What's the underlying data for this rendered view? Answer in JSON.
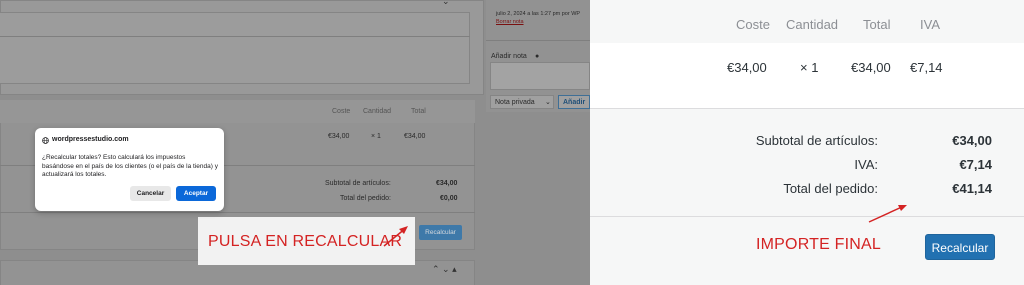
{
  "left": {
    "note_meta": "julio 2, 2024 a las 1:27 pm por WP",
    "delete_note": "Borrar nota",
    "add_note_label": "Añadir nota",
    "note_type_select": "Nota privada",
    "add_note_button": "Añadir",
    "table_headers": {
      "cost": "Coste",
      "quantity": "Cantidad",
      "total": "Total"
    },
    "item": {
      "cost": "€34,00",
      "quantity": "× 1",
      "total": "€34,00"
    },
    "subtotal_label": "Subtotal de artículos:",
    "subtotal_value": "€34,00",
    "order_total_label": "Total del pedido:",
    "order_total_value": "€0,00",
    "recalc_button": "Recalcular",
    "annotation": "PULSA EN RECALCULAR"
  },
  "dialog": {
    "domain": "wordpressestudio.com",
    "message": "¿Recalcular totales? Esto calculará los impuestos basándose en el país de los clientes (o el país de la tienda) y actualizará los totales.",
    "cancel": "Cancelar",
    "accept": "Aceptar"
  },
  "right": {
    "headers": {
      "cost": "Coste",
      "quantity": "Cantidad",
      "total": "Total",
      "tax": "IVA"
    },
    "item": {
      "cost": "€34,00",
      "quantity": "× 1",
      "total": "€34,00",
      "tax": "€7,14"
    },
    "totals": [
      {
        "label": "Subtotal de artículos:",
        "value": "€34,00"
      },
      {
        "label": "IVA:",
        "value": "€7,14"
      },
      {
        "label": "Total del pedido:",
        "value": "€41,14"
      }
    ],
    "annotation": "IMPORTE FINAL",
    "recalc_button": "Recalcular"
  },
  "colors": {
    "primary_button": "#2271b1",
    "annotation_red": "#d42323",
    "dialog_accept": "#0b68d9"
  }
}
